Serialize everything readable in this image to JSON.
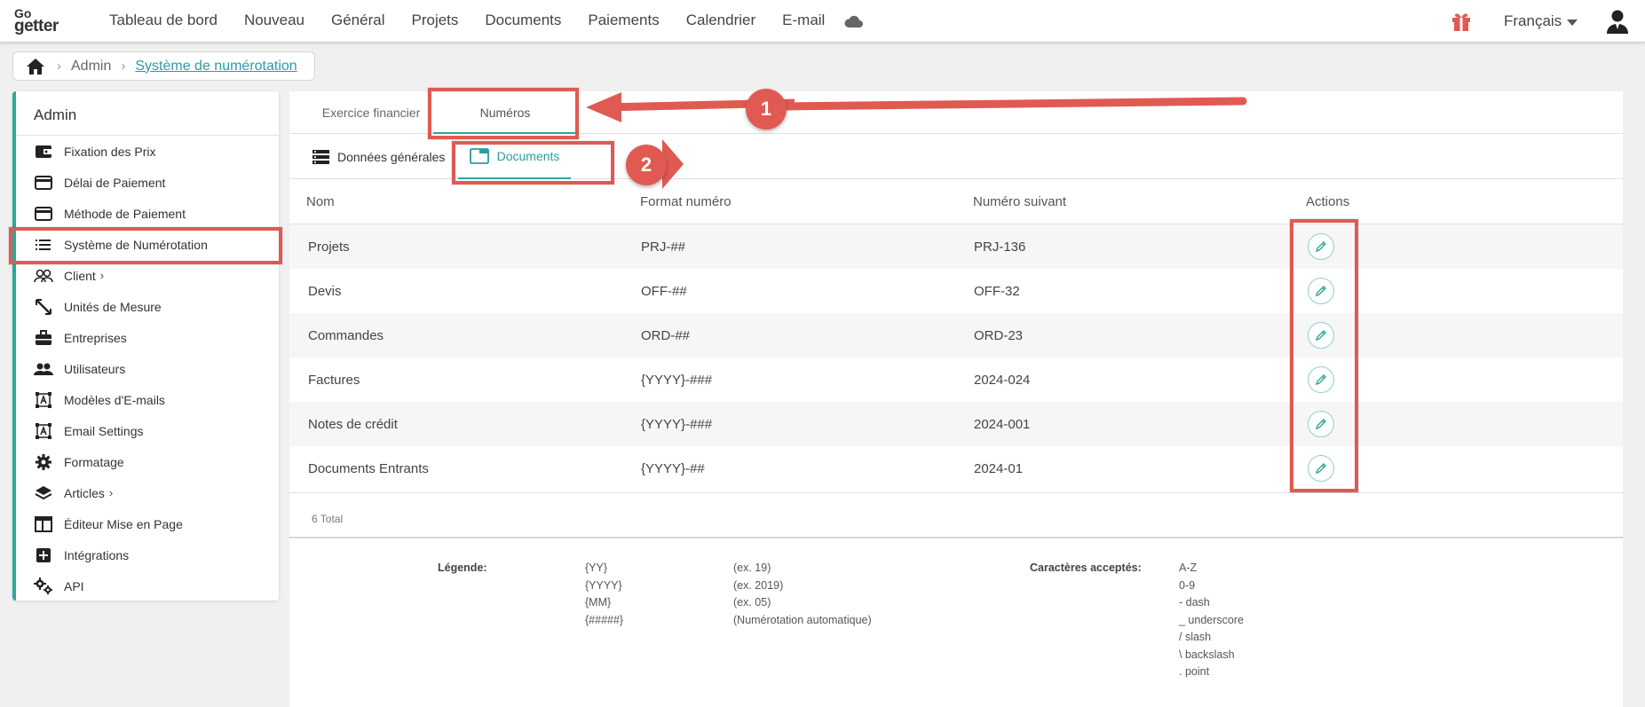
{
  "app": {
    "logo_top": "Go",
    "logo_bottom": "getter"
  },
  "nav": {
    "items": [
      {
        "label": "Tableau de bord"
      },
      {
        "label": "Nouveau"
      },
      {
        "label": "Général"
      },
      {
        "label": "Projets"
      },
      {
        "label": "Documents"
      },
      {
        "label": "Paiements"
      },
      {
        "label": "Calendrier"
      },
      {
        "label": "E-mail"
      }
    ],
    "language": "Français"
  },
  "breadcrumb": {
    "items": [
      "Admin",
      "Système de numérotation"
    ]
  },
  "sidebar": {
    "title": "Admin",
    "items": [
      {
        "label": "Fixation des Prix",
        "icon": "wallet-icon"
      },
      {
        "label": "Délai de Paiement",
        "icon": "credit-card-icon"
      },
      {
        "label": "Méthode de Paiement",
        "icon": "credit-card-icon"
      },
      {
        "label": "Système de Numérotation",
        "icon": "list-icon"
      },
      {
        "label": "Client",
        "icon": "people-icon",
        "has_children": true
      },
      {
        "label": "Unités de Mesure",
        "icon": "ruler-icon"
      },
      {
        "label": "Entreprises",
        "icon": "briefcase-icon"
      },
      {
        "label": "Utilisateurs",
        "icon": "users-icon"
      },
      {
        "label": "Modèles d'E-mails",
        "icon": "text-frame-icon"
      },
      {
        "label": "Email Settings",
        "icon": "text-frame-icon"
      },
      {
        "label": "Formatage",
        "icon": "gear-icon"
      },
      {
        "label": "Articles",
        "icon": "layers-icon",
        "has_children": true
      },
      {
        "label": "Éditeur Mise en Page",
        "icon": "layout-icon"
      },
      {
        "label": "Intégrations",
        "icon": "plus-box-icon"
      },
      {
        "label": "API",
        "icon": "gears-icon"
      }
    ]
  },
  "tabs": {
    "primary": [
      "Exercice financier",
      "Numéros"
    ],
    "secondary": [
      "Données générales",
      "Documents"
    ]
  },
  "table": {
    "columns": [
      "Nom",
      "Format numéro",
      "Numéro suivant",
      "Actions"
    ],
    "rows": [
      {
        "name": "Projets",
        "format": "PRJ-##",
        "next": "PRJ-136"
      },
      {
        "name": "Devis",
        "format": "OFF-##",
        "next": "OFF-32"
      },
      {
        "name": "Commandes",
        "format": "ORD-##",
        "next": "ORD-23"
      },
      {
        "name": "Factures",
        "format": "{YYYY}-###",
        "next": "2024-024"
      },
      {
        "name": "Notes de crédit",
        "format": "{YYYY}-###",
        "next": "2024-001"
      },
      {
        "name": "Documents Entrants",
        "format": "{YYYY}-##",
        "next": "2024-01"
      }
    ],
    "total": "6 Total"
  },
  "legend": {
    "label": "Légende:",
    "codes": [
      "{YY}",
      "{YYYY}",
      "{MM}",
      "{#####}"
    ],
    "examples": [
      "(ex. 19)",
      "(ex. 2019)",
      "(ex. 05)",
      "(Numérotation automatique)"
    ],
    "accepted_label": "Caractères acceptés:",
    "accepted": [
      "A-Z",
      "0-9",
      "- dash",
      "_ underscore",
      "/ slash",
      "\\ backslash",
      ". point"
    ]
  },
  "annotations": {
    "badge1": "1",
    "badge2": "2"
  },
  "colors": {
    "accent": "#2aa89a",
    "link": "#2a9da3",
    "annotation": "#e05a52"
  }
}
